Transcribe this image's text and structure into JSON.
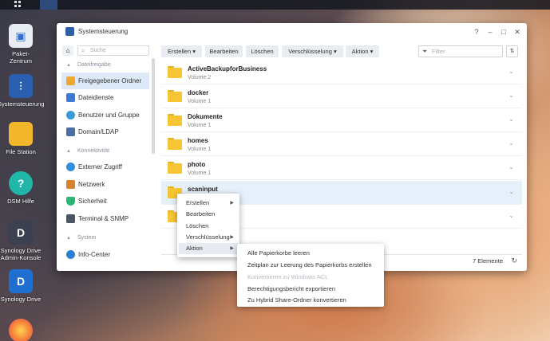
{
  "desktop": {
    "icons": [
      {
        "label": "Paket-\nZentrum",
        "line1": "Paket-",
        "line2": "Zentrum"
      },
      {
        "label": "Systemsteuerung"
      },
      {
        "label": "File Station"
      },
      {
        "label": "DSM Hilfe"
      },
      {
        "label": "Synology Drive Admin-Konsole",
        "line1": "Synology Drive",
        "line2": "Admin-Konsole"
      },
      {
        "label": "Synology Drive"
      }
    ]
  },
  "window": {
    "title": "Systemsteuerung",
    "controls": {
      "help": "?",
      "minimize": "–",
      "maximize": "□",
      "close": "✕"
    }
  },
  "sidebar": {
    "search_placeholder": "Suche",
    "sections": [
      {
        "title": "Dateifreigabe"
      },
      {
        "title": "Konnektivität"
      },
      {
        "title": "System"
      }
    ],
    "items": [
      {
        "label": "Freigegebener Ordner",
        "color": "#f0a830"
      },
      {
        "label": "Dateidienste",
        "color": "#3a7bd5"
      },
      {
        "label": "Benutzer und Gruppe",
        "color": "#3a9ad5"
      },
      {
        "label": "Domain/LDAP",
        "color": "#4a6fa5"
      },
      {
        "label": "Externer Zugriff",
        "color": "#2f8fdc"
      },
      {
        "label": "Netzwerk",
        "color": "#d9822b"
      },
      {
        "label": "Sicherheit",
        "color": "#2bb673"
      },
      {
        "label": "Terminal & SNMP",
        "color": "#4a5566"
      },
      {
        "label": "Info-Center",
        "color": "#2a7fd4"
      }
    ]
  },
  "toolbar": {
    "create": "Erstellen",
    "edit": "Bearbeiten",
    "delete": "Löschen",
    "encryption": "Verschlüsselung",
    "action": "Aktion",
    "filter_placeholder": "Filter"
  },
  "folders": [
    {
      "name": "ActiveBackupforBusiness",
      "volume": "Volume 2"
    },
    {
      "name": "docker",
      "volume": "Volume 1"
    },
    {
      "name": "Dokumente",
      "volume": "Volume 1"
    },
    {
      "name": "homes",
      "volume": "Volume 1"
    },
    {
      "name": "photo",
      "volume": "Volume 1"
    },
    {
      "name": "scaninput",
      "volume": ""
    },
    {
      "name": "",
      "volume": ""
    }
  ],
  "footer": {
    "item_count": "7 Elemente"
  },
  "context_menu": {
    "items": [
      "Erstellen",
      "Bearbeiten",
      "Löschen",
      "Verschlüsselung",
      "Aktion"
    ]
  },
  "sub_menu": {
    "items": [
      {
        "label": "Alle Papierkorbe leeren",
        "enabled": true
      },
      {
        "label": "Zeitplan zur Leerung des Papierkorbs erstellen",
        "enabled": true
      },
      {
        "label": "Konvertieren zu Windows ACL",
        "enabled": false
      },
      {
        "label": "Berechtigungsbericht exportieren",
        "enabled": true
      },
      {
        "label": "Zu Hybrid Share-Ordner konvertieren",
        "enabled": true
      }
    ]
  }
}
